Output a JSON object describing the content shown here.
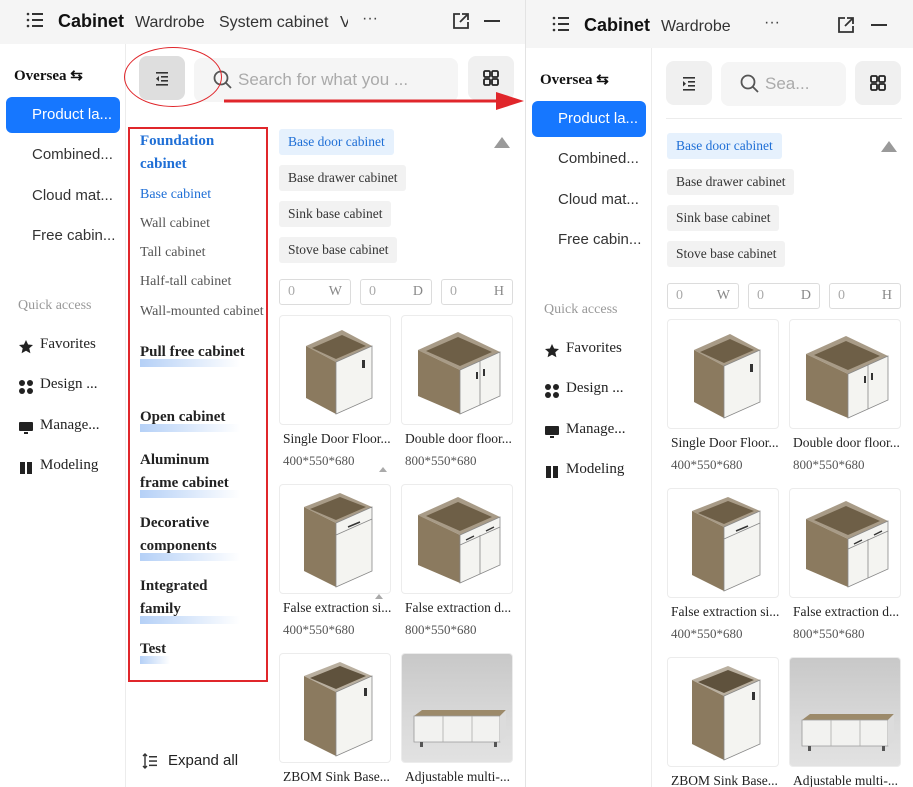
{
  "header": {
    "title": "Cabinet",
    "tabs": [
      "Wardrobe",
      "System cabinet",
      "V"
    ],
    "more_label": "···"
  },
  "sidebar": {
    "switch_label": "Oversea",
    "nav": [
      {
        "label": "Product la...",
        "active": true
      },
      {
        "label": "Combined..."
      },
      {
        "label": "Cloud mat..."
      },
      {
        "label": "Free cabin..."
      }
    ],
    "quick_access_label": "Quick access",
    "quick_access": [
      {
        "label": "Favorites",
        "icon": "star-icon"
      },
      {
        "label": "Design ...",
        "icon": "grid-icon"
      },
      {
        "label": "Manage...",
        "icon": "monitor-icon"
      },
      {
        "label": "Modeling",
        "icon": "cube-icon"
      }
    ]
  },
  "search": {
    "placeholder_wide": "Search for what you ...",
    "placeholder_narrow": "Sea..."
  },
  "categories": {
    "groups": [
      {
        "label": "Foundation cabinet",
        "open": true,
        "subs": [
          "Base cabinet",
          "Wall cabinet",
          "Tall cabinet",
          "Half-tall cabinet",
          "Wall-mounted cabinet"
        ]
      },
      {
        "label": "Pull free cabinet"
      },
      {
        "label": "Open cabinet"
      },
      {
        "label": "Aluminum frame cabinet"
      },
      {
        "label": "Decorative components"
      },
      {
        "label": "Integrated family"
      },
      {
        "label": "Test"
      }
    ],
    "expand_all_label": "Expand all"
  },
  "tags": [
    {
      "label": "Base door cabinet",
      "active": true
    },
    {
      "label": "Base drawer cabinet"
    },
    {
      "label": "Sink base cabinet"
    },
    {
      "label": "Stove base cabinet"
    }
  ],
  "dimensions": [
    {
      "value": "0",
      "unit": "W"
    },
    {
      "value": "0",
      "unit": "D"
    },
    {
      "value": "0",
      "unit": "H"
    }
  ],
  "products": [
    {
      "name": "Single Door Floor...",
      "size": "400*550*680"
    },
    {
      "name": "Double door floor...",
      "size": "800*550*680"
    },
    {
      "name": "False extraction si...",
      "size": "400*550*680"
    },
    {
      "name": "False extraction d...",
      "size": "800*550*680"
    },
    {
      "name": "ZBOM Sink Base...",
      "size": ""
    },
    {
      "name": "Adjustable multi-...",
      "size": ""
    }
  ],
  "colors": {
    "accent": "#1677ff",
    "annotation": "#e0262b",
    "wood": "#8b7a5f",
    "door": "#f4f4f1"
  }
}
